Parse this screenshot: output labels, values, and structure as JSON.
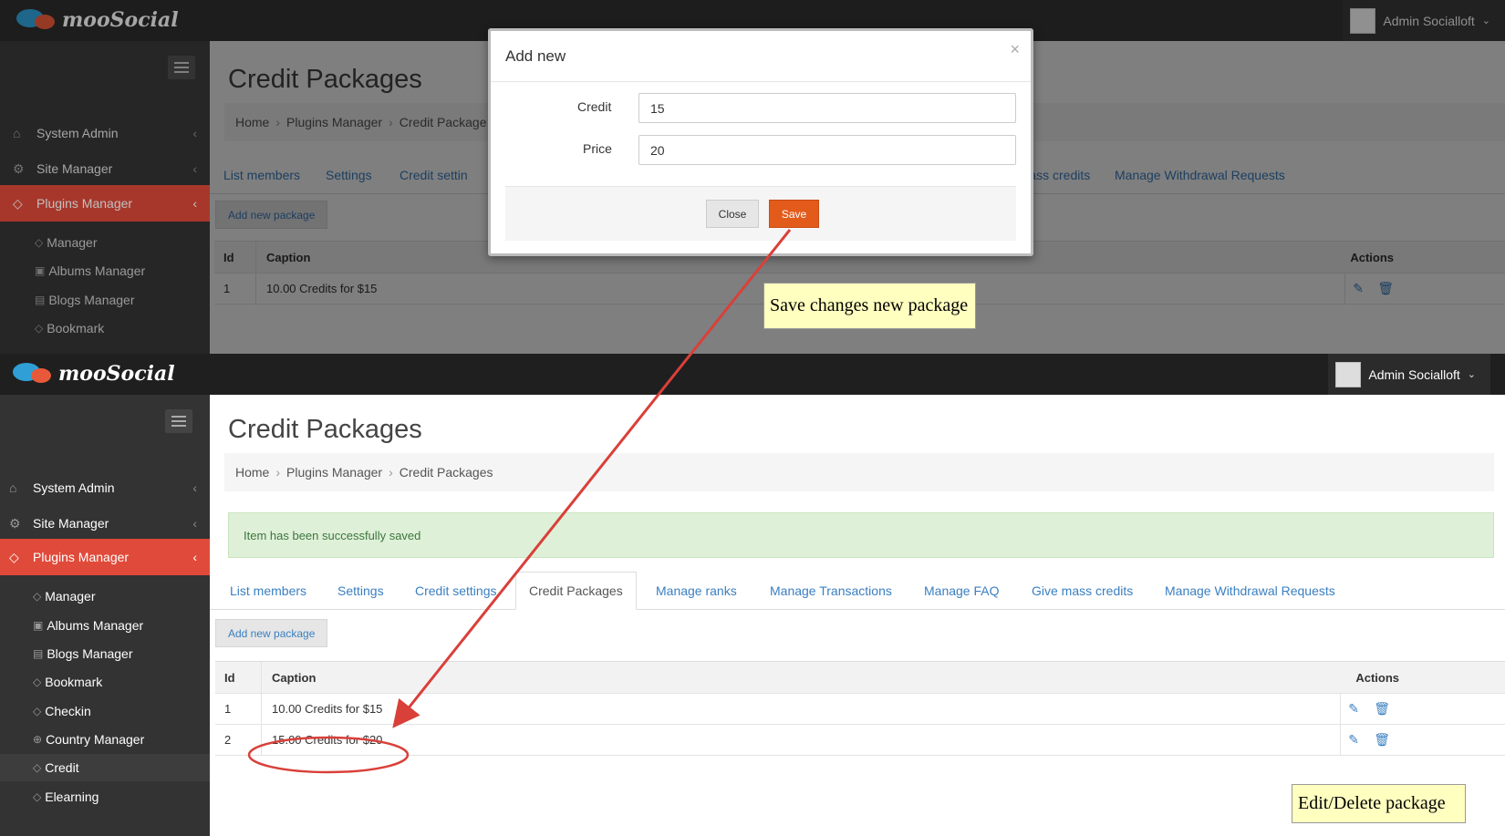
{
  "brand": {
    "name": "mooSocial"
  },
  "user": {
    "name": "Admin Socialloft"
  },
  "sidebar": {
    "items": [
      {
        "label": "System Admin"
      },
      {
        "label": "Site Manager"
      },
      {
        "label": "Plugins Manager"
      }
    ],
    "subitems_top": [
      "Manager",
      "Albums Manager",
      "Blogs Manager",
      "Bookmark"
    ],
    "subitems_bottom": [
      "Manager",
      "Albums Manager",
      "Blogs Manager",
      "Bookmark",
      "Checkin",
      "Country Manager",
      "Credit",
      "Elearning"
    ]
  },
  "page": {
    "title": "Credit Packages",
    "breadcrumb": [
      "Home",
      "Plugins Manager",
      "Credit Packages"
    ],
    "top_breadcrumb_last": "Credit Package",
    "alert": "Item has been successfully saved",
    "tabs": [
      "List members",
      "Settings",
      "Credit settings",
      "Credit Packages",
      "Manage ranks",
      "Manage Transactions",
      "Manage FAQ",
      "Give mass credits",
      "Manage Withdrawal Requests"
    ],
    "top_tabs": {
      "t0": "List members",
      "t1": "Settings",
      "t2": "Credit settin",
      "t7": "Give mass credits",
      "t8": "Manage Withdrawal Requests"
    },
    "add_button": "Add new package",
    "table": {
      "headers": {
        "id": "Id",
        "caption": "Caption",
        "actions": "Actions"
      },
      "rows_top": [
        {
          "id": "1",
          "caption": "10.00 Credits for $15"
        }
      ],
      "rows": [
        {
          "id": "1",
          "caption": "10.00 Credits for $15"
        },
        {
          "id": "2",
          "caption": "15.00 Credits for $20"
        }
      ]
    }
  },
  "modal": {
    "title": "Add new",
    "close_x": "×",
    "credit_label": "Credit",
    "credit_value": "15",
    "price_label": "Price",
    "price_value": "20",
    "close_button": "Close",
    "save_button": "Save"
  },
  "annotations": {
    "save_note": "Save changes new package",
    "edit_note": "Edit/Delete package",
    "color": "#d9403a"
  }
}
